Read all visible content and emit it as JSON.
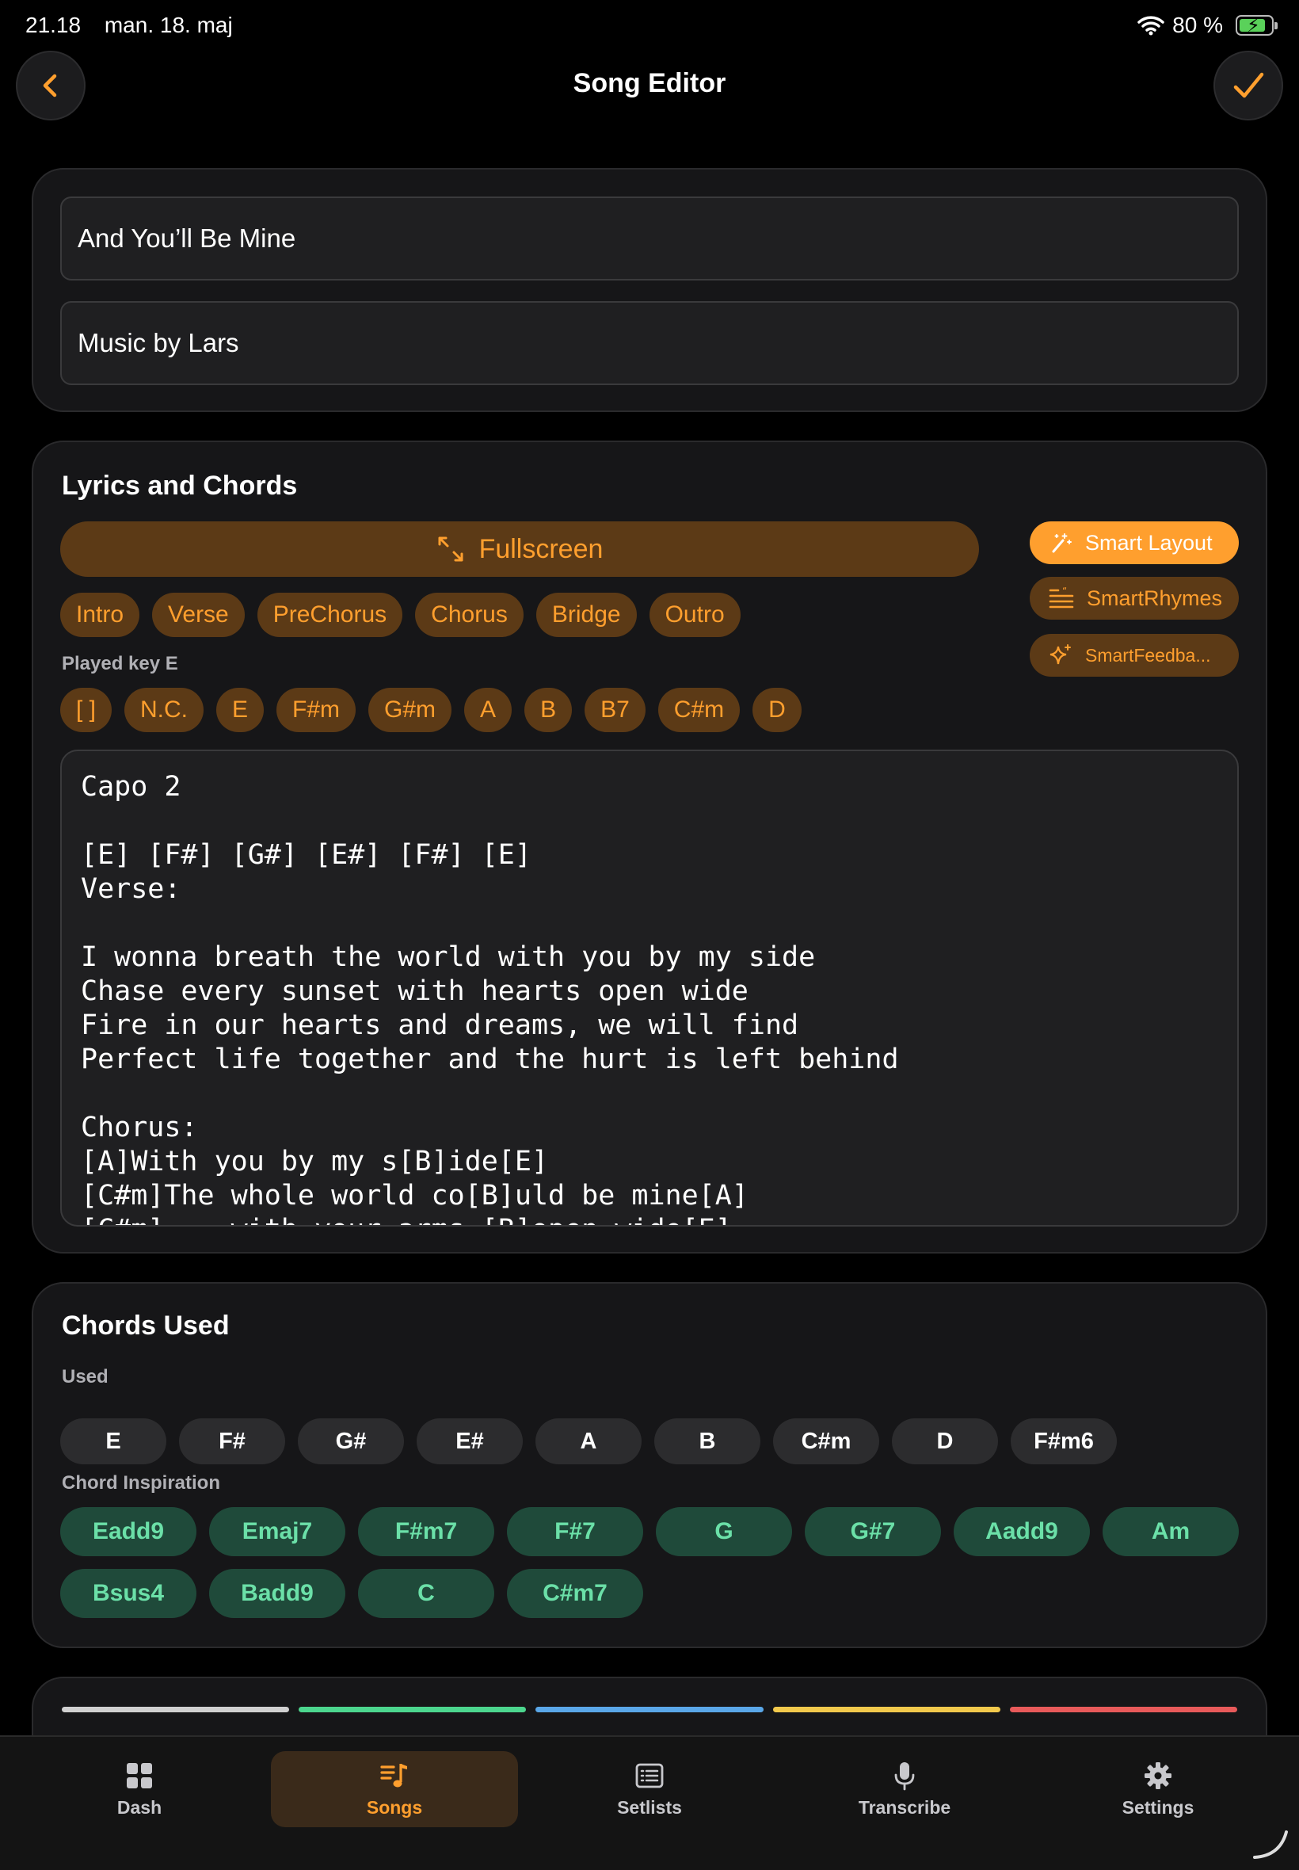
{
  "status": {
    "time": "21.18",
    "date": "man. 18. maj",
    "battery": "80 %",
    "battery_level": 0.8
  },
  "nav": {
    "title": "Song Editor",
    "back_icon": "chevron-left-icon",
    "done_icon": "checkmark-icon"
  },
  "song": {
    "title": "And You’ll Be Mine",
    "artist": "Music by Lars"
  },
  "lyrics": {
    "section_title": "Lyrics and Chords",
    "fullscreen_label": "Fullscreen",
    "sections": [
      "Intro",
      "Verse",
      "PreChorus",
      "Chorus",
      "Bridge",
      "Outro"
    ],
    "played_key_label": "Played key E",
    "key_chords": [
      "[ ]",
      "N.C.",
      "E",
      "F#m",
      "G#m",
      "A",
      "B",
      "B7",
      "C#m",
      "D"
    ],
    "smart_layout_label": "Smart Layout",
    "smart_rhymes_label": "SmartRhymes",
    "smart_feedback_label": "SmartFeedba...",
    "editor_text": "Capo 2\n\n[E] [F#] [G#] [E#] [F#] [E]\nVerse:\n\nI wonna breath the world with you by my side\nChase every sunset with hearts open wide\nFire in our hearts and dreams, we will find\nPerfect life together and the hurt is left behind\n\nChorus:\n[A]With you by my s[B]ide[E]\n[C#m]The whole world co[B]uld be mine[A]\n[C#m]... with your arms [B]open wide[E]"
  },
  "chords_used": {
    "section_title": "Chords Used",
    "used_label": "Used",
    "used": [
      "E",
      "F#",
      "G#",
      "E#",
      "A",
      "B",
      "C#m",
      "D",
      "F#m6"
    ],
    "inspiration_label": "Chord Inspiration",
    "inspiration": [
      "Eadd9",
      "Emaj7",
      "F#m7",
      "F#7",
      "G",
      "G#7",
      "Aadd9",
      "Am",
      "Bsus4",
      "Badd9",
      "C",
      "C#m7"
    ]
  },
  "color_bars": [
    "#d0d0d0",
    "#4cd68e",
    "#5aa7e8",
    "#f2c94c",
    "#e85a5a"
  ],
  "colors": {
    "accent": "#ff9f2e",
    "accent_dark": "#5c3a16",
    "green_text": "#6be0a8",
    "green_bg": "#1f4a3a"
  },
  "tabs": [
    {
      "label": "Dash",
      "icon": "grid-icon",
      "active": false
    },
    {
      "label": "Songs",
      "icon": "music-list-icon",
      "active": true
    },
    {
      "label": "Setlists",
      "icon": "list-icon",
      "active": false
    },
    {
      "label": "Transcribe",
      "icon": "microphone-icon",
      "active": false
    },
    {
      "label": "Settings",
      "icon": "gear-icon",
      "active": false
    }
  ]
}
